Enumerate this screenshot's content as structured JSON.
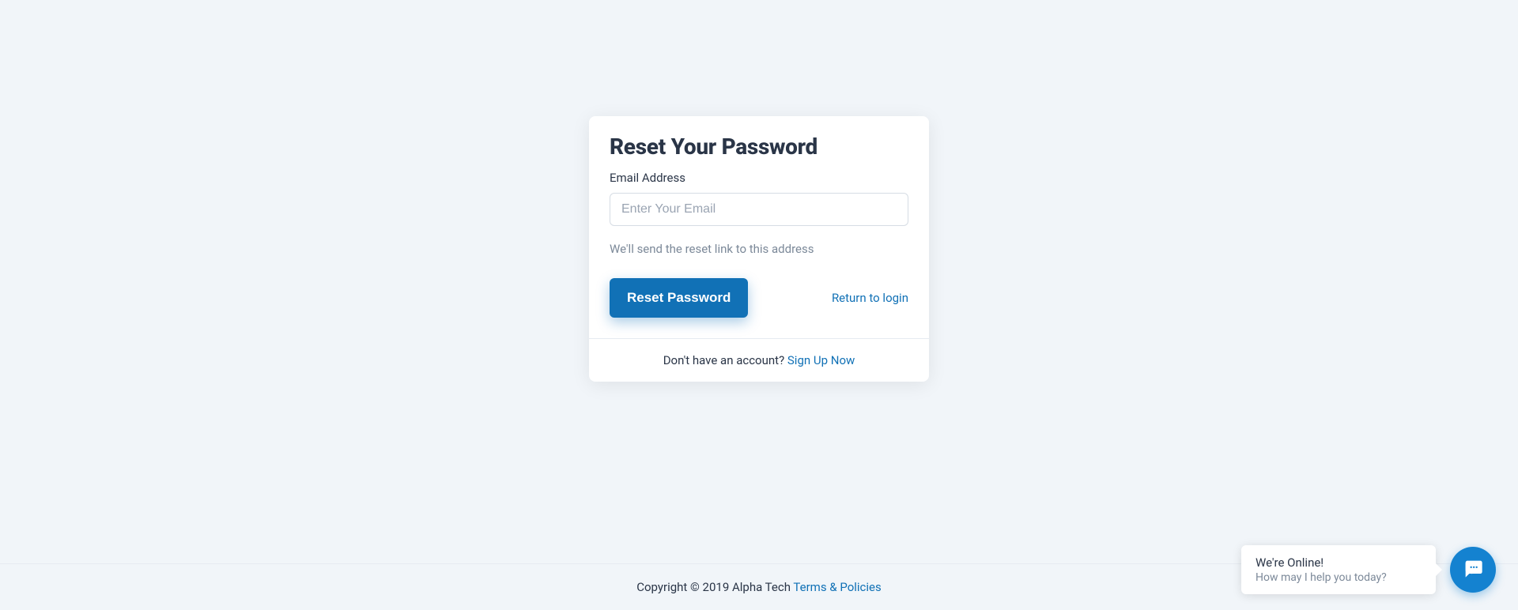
{
  "card": {
    "title": "Reset Your Password",
    "emailLabel": "Email Address",
    "emailPlaceholder": "Enter Your Email",
    "helperText": "We'll send the reset link to this address",
    "resetButton": "Reset Password",
    "returnLink": "Return to login",
    "footerPrompt": "Don't have an account? ",
    "signupLink": "Sign Up Now"
  },
  "footer": {
    "copyright": "Copyright © 2019 Alpha Tech ",
    "termsLink": "Terms & Policies"
  },
  "chat": {
    "title": "We're Online!",
    "subtitle": "How may I help you today?"
  }
}
